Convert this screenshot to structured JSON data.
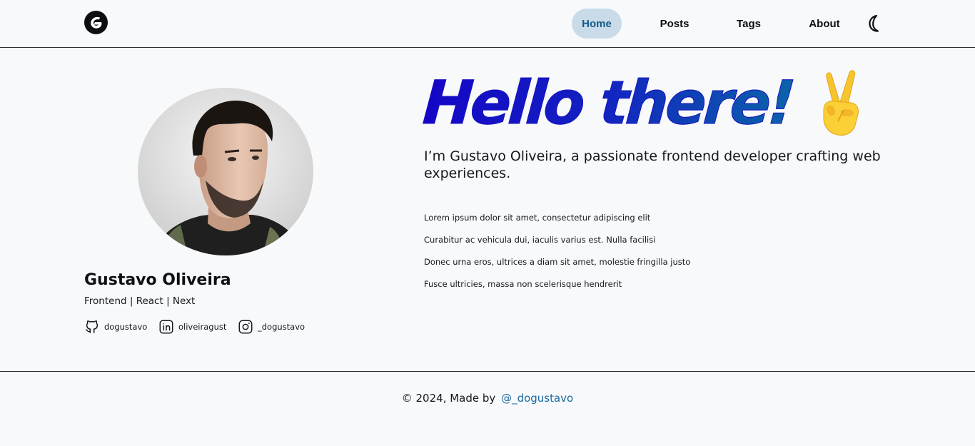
{
  "header": {
    "logo_icon": "g-logo-icon",
    "nav": [
      {
        "label": "Home",
        "active": true
      },
      {
        "label": "Posts",
        "active": false
      },
      {
        "label": "Tags",
        "active": false
      },
      {
        "label": "About",
        "active": false
      }
    ],
    "theme_toggle_icon": "moon-icon",
    "active_color": "#135a8a",
    "active_bg": "#c9dbe8"
  },
  "profile": {
    "name": "Gustavo Oliveira",
    "tagline": "Frontend | React | Next",
    "socials": [
      {
        "icon": "github-icon",
        "label": "dogustavo"
      },
      {
        "icon": "linkedin-icon",
        "label": "oliveiragust"
      },
      {
        "icon": "instagram-icon",
        "label": "_dogustavo"
      }
    ]
  },
  "hero": {
    "title": "Hello there!",
    "emoji_icon": "victory-hand-icon",
    "subtitle": "I’m Gustavo Oliveira, a passionate frontend developer crafting web experiences.",
    "bio_lines": [
      "Lorem ipsum dolor sit amet, consectetur adipiscing elit",
      "Curabitur ac vehicula dui, iaculis varius est. Nulla facilisi",
      "Donec urna eros, ultrices a diam sit amet, molestie fringilla justo",
      "Fusce ultricies, massa non scelerisque hendrerit"
    ],
    "title_gradient": [
      "#1505c7",
      "#0b63a9"
    ]
  },
  "footer": {
    "prefix": "© 2024, Made by",
    "link": "@_dogustavo",
    "link_color": "#1d6a9e"
  }
}
